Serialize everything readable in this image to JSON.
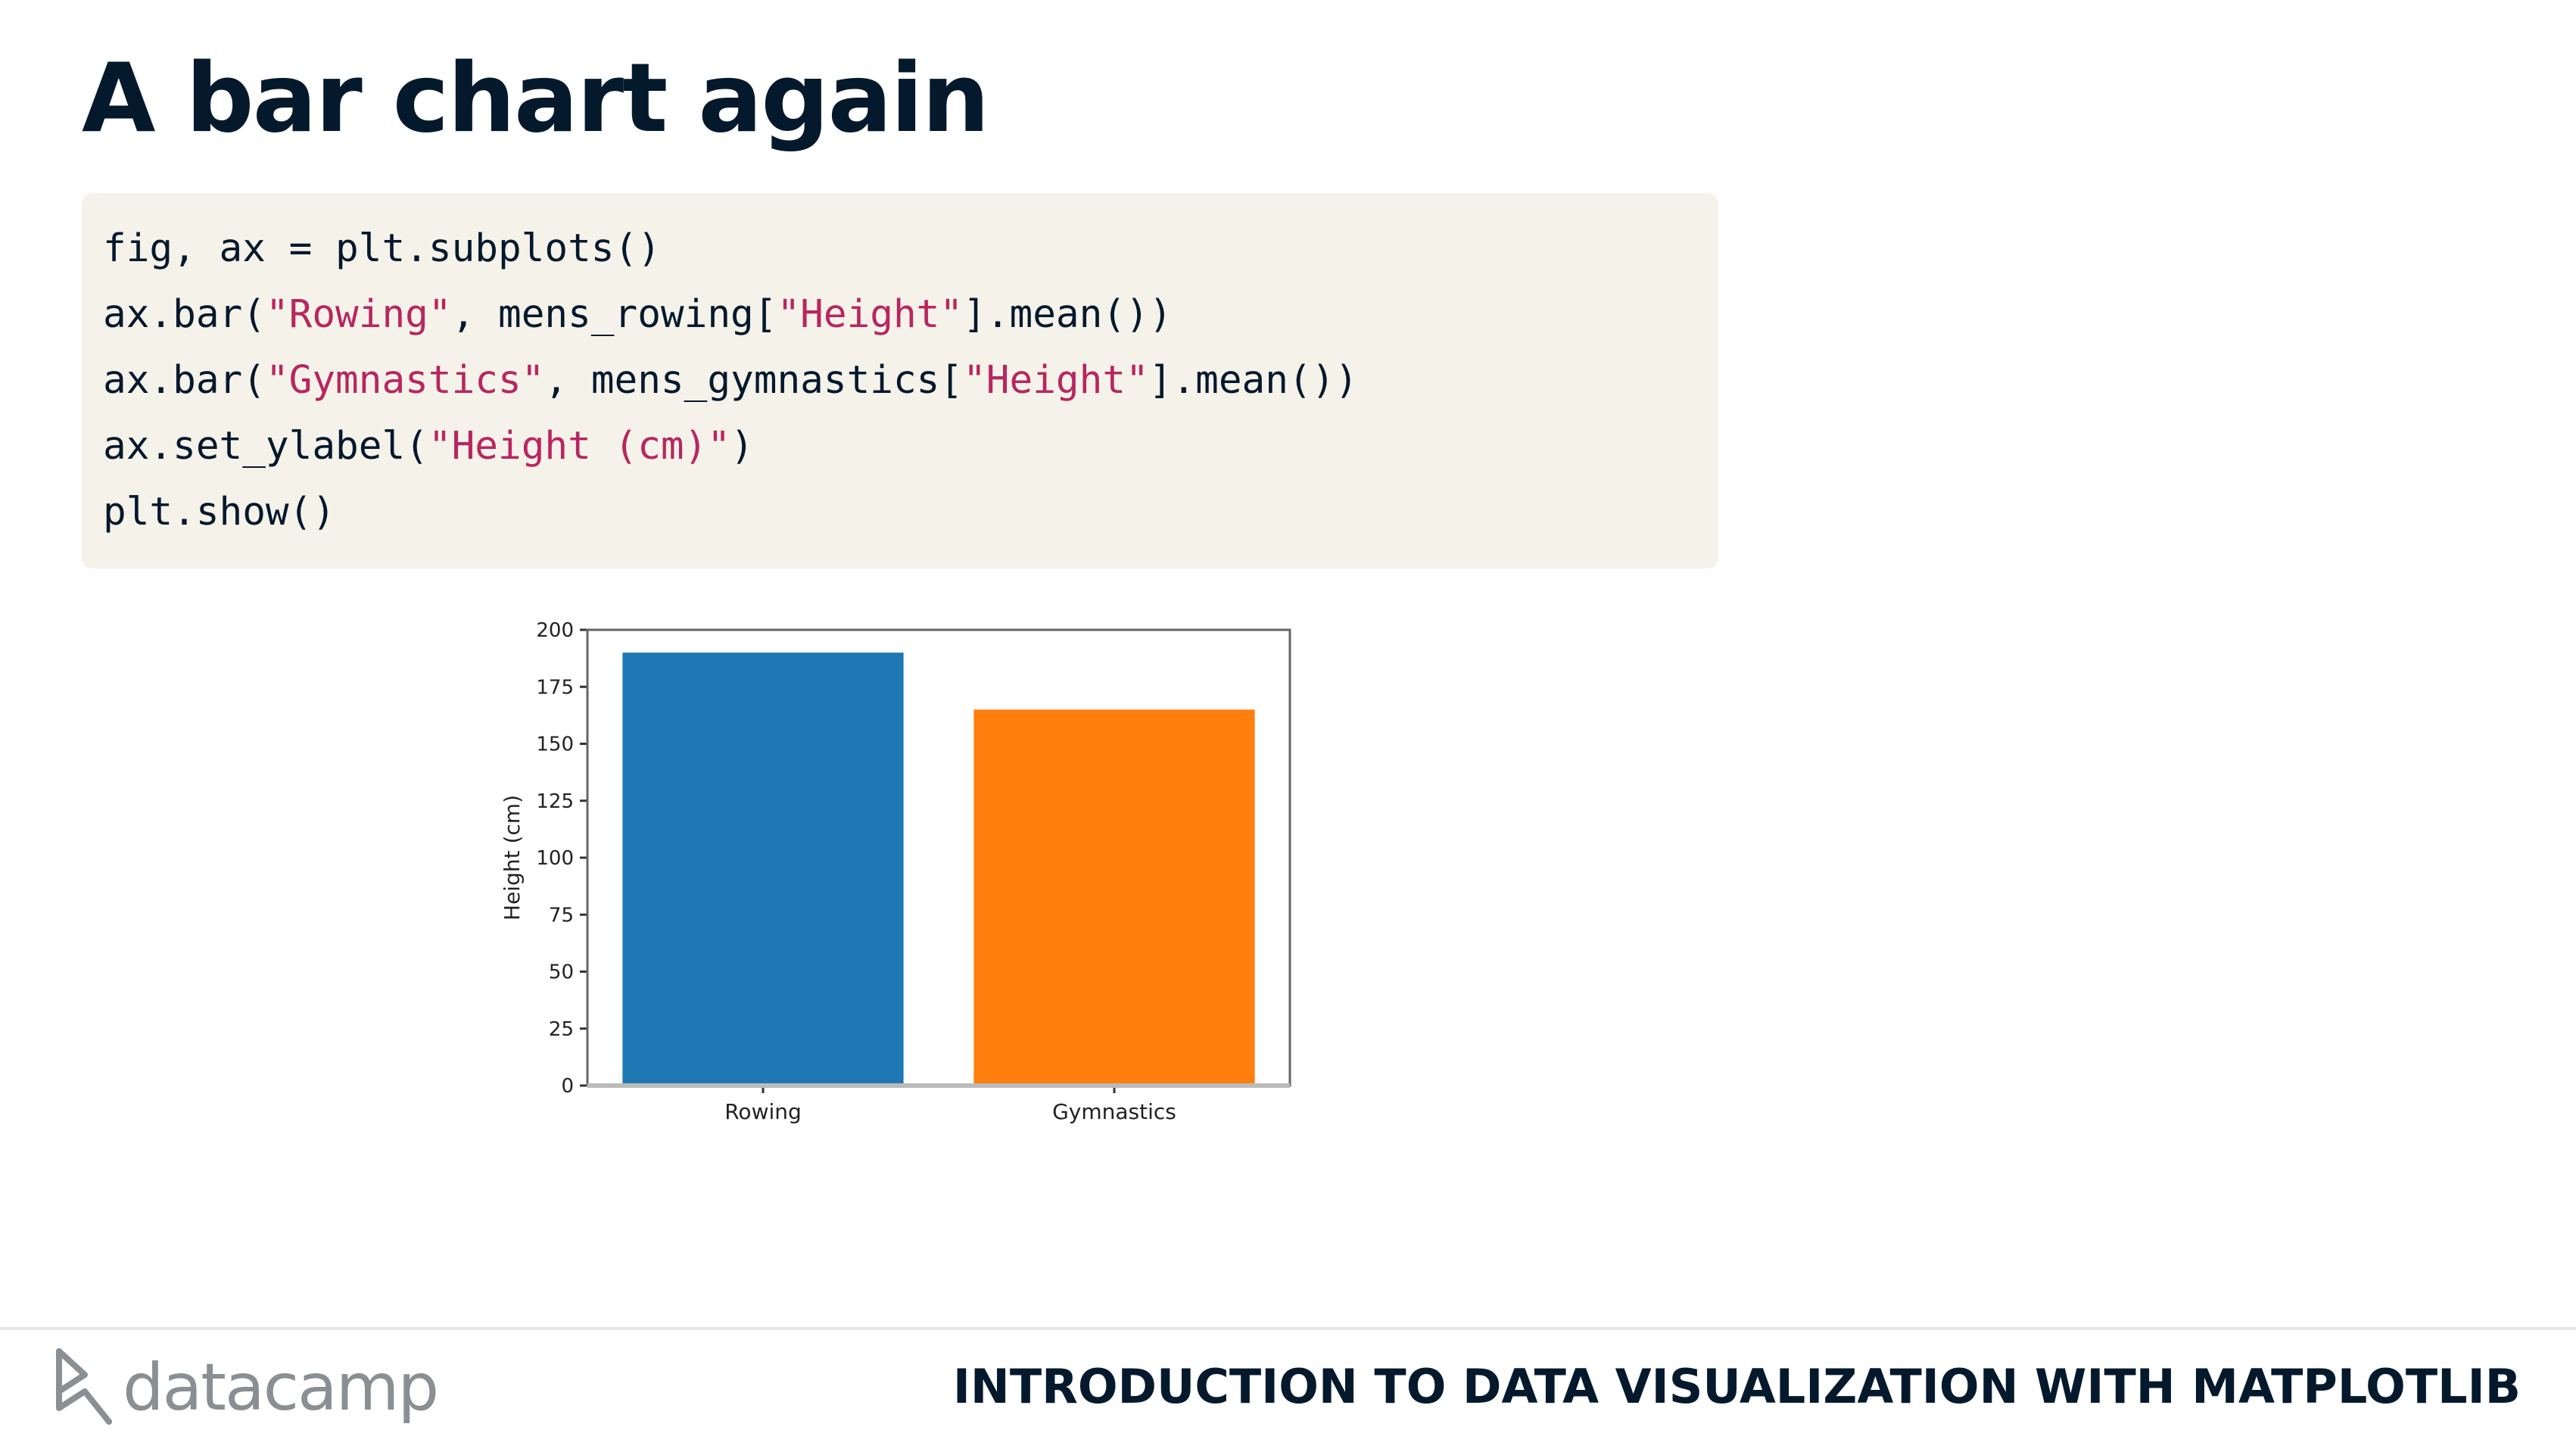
{
  "slide": {
    "title": "A bar chart again"
  },
  "code": {
    "lines": [
      [
        {
          "t": "fig, ax = plt.subplots()",
          "c": "plain"
        }
      ],
      [
        {
          "t": "ax.bar(",
          "c": "plain"
        },
        {
          "t": "\"Rowing\"",
          "c": "str"
        },
        {
          "t": ", mens_rowing[",
          "c": "plain"
        },
        {
          "t": "\"Height\"",
          "c": "str"
        },
        {
          "t": "].mean())",
          "c": "plain"
        }
      ],
      [
        {
          "t": "ax.bar(",
          "c": "plain"
        },
        {
          "t": "\"Gymnastics\"",
          "c": "str"
        },
        {
          "t": ", mens_gymnastics[",
          "c": "plain"
        },
        {
          "t": "\"Height\"",
          "c": "str"
        },
        {
          "t": "].mean())",
          "c": "plain"
        }
      ],
      [
        {
          "t": "ax.set_ylabel(",
          "c": "plain"
        },
        {
          "t": "\"Height (cm)\"",
          "c": "str"
        },
        {
          "t": ")",
          "c": "plain"
        }
      ],
      [
        {
          "t": "plt.show()",
          "c": "plain"
        }
      ]
    ]
  },
  "chart_data": {
    "type": "bar",
    "categories": [
      "Rowing",
      "Gymnastics"
    ],
    "values": [
      190,
      165
    ],
    "colors": [
      "#1f77b4",
      "#ff7f0e"
    ],
    "ylabel": "Height (cm)",
    "ylim": [
      0,
      200
    ],
    "yticks": [
      0,
      25,
      50,
      75,
      100,
      125,
      150,
      175,
      200
    ],
    "grid": false
  },
  "footer": {
    "brand": "datacamp",
    "course": "INTRODUCTION TO DATA VISUALIZATION WITH MATPLOTLIB"
  },
  "colors": {
    "title": "#05192d",
    "code_bg": "#f5f2ea",
    "code_string": "#b8265f",
    "logo_gray": "#8a8f94"
  }
}
